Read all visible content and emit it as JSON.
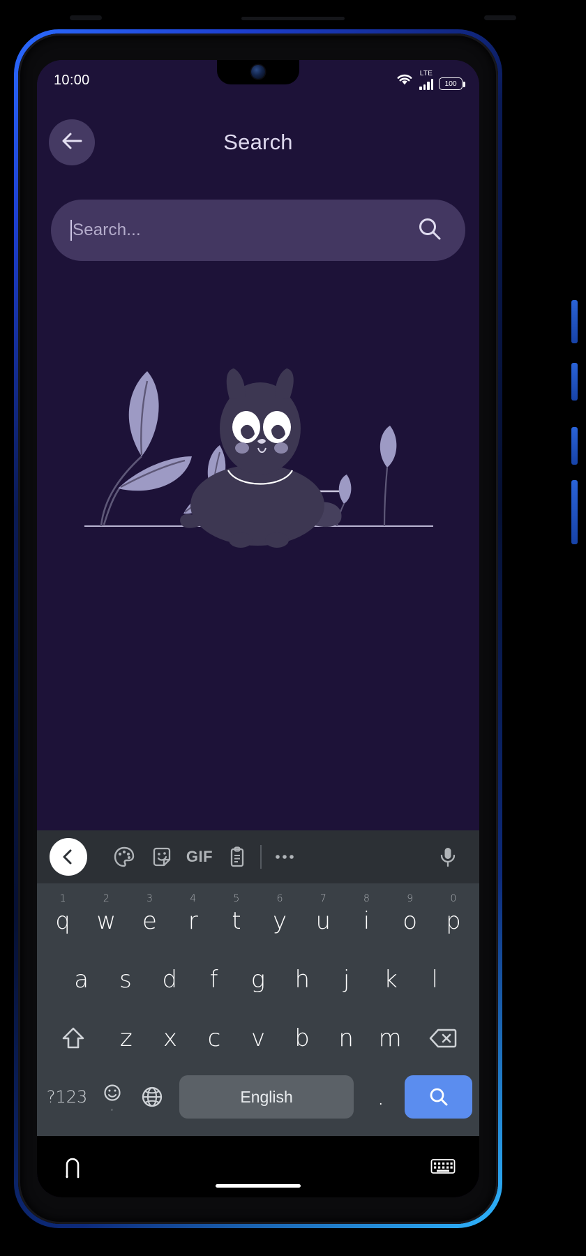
{
  "status_bar": {
    "time": "10:00",
    "wifi_icon": "wifi-icon",
    "network_label": "LTE",
    "signal_icon": "signal-bars-icon",
    "battery_level": "100"
  },
  "app_bar": {
    "back_icon": "arrow-left-icon",
    "title": "Search"
  },
  "search": {
    "placeholder": "Search...",
    "value": "",
    "search_icon": "search-icon"
  },
  "illustration": {
    "name": "empty-state-cat-illustration",
    "cat_body_color": "#3d3752",
    "leaf_color": "#9d9ac4",
    "ground_color": "#c8c4dd"
  },
  "theme": {
    "app_background": "#1d1238",
    "search_field_background": "#433761",
    "back_button_background": "#453a63",
    "title_color": "#ded9ee",
    "keyboard_toolbar_background": "#2c3035",
    "keyboard_background": "#3a4046",
    "spacebar_color": "#5b6167",
    "enter_key_color": "#5b8def",
    "frame_accent": "#2b6bff"
  },
  "keyboard": {
    "toolbar": [
      {
        "name": "collapse-toolbar-button",
        "icon": "chevron-left-icon",
        "label": ""
      },
      {
        "name": "theme-button",
        "icon": "palette-icon",
        "label": ""
      },
      {
        "name": "sticker-button",
        "icon": "sticker-icon",
        "label": ""
      },
      {
        "name": "gif-button",
        "icon": "gif-icon",
        "label": "GIF"
      },
      {
        "name": "clipboard-button",
        "icon": "clipboard-icon",
        "label": ""
      },
      {
        "name": "more-options-button",
        "icon": "ellipsis-icon",
        "label": ""
      },
      {
        "name": "voice-input-button",
        "icon": "microphone-icon",
        "label": ""
      }
    ],
    "row1": [
      {
        "key": "q",
        "num": "1"
      },
      {
        "key": "w",
        "num": "2"
      },
      {
        "key": "e",
        "num": "3"
      },
      {
        "key": "r",
        "num": "4"
      },
      {
        "key": "t",
        "num": "5"
      },
      {
        "key": "y",
        "num": "6"
      },
      {
        "key": "u",
        "num": "7"
      },
      {
        "key": "i",
        "num": "8"
      },
      {
        "key": "o",
        "num": "9"
      },
      {
        "key": "p",
        "num": "0"
      }
    ],
    "row2": [
      {
        "key": "a"
      },
      {
        "key": "s"
      },
      {
        "key": "d"
      },
      {
        "key": "f"
      },
      {
        "key": "g"
      },
      {
        "key": "h"
      },
      {
        "key": "j"
      },
      {
        "key": "k"
      },
      {
        "key": "l"
      }
    ],
    "row3": [
      {
        "key": "z"
      },
      {
        "key": "x"
      },
      {
        "key": "c"
      },
      {
        "key": "v"
      },
      {
        "key": "b"
      },
      {
        "key": "n"
      },
      {
        "key": "m"
      }
    ],
    "shift_icon": "shift-arrow-icon",
    "backspace_icon": "backspace-icon",
    "symbols_label": "?123",
    "emoji_icon": "emoji-smiley-icon",
    "comma_label": ",",
    "language_switch_icon": "globe-icon",
    "space_label": "English",
    "period_label": ".",
    "enter_icon": "search-icon"
  },
  "nav_bar": {
    "back_icon": "nav-back-icon",
    "home_indicator": "home-pill-indicator",
    "keyboard_icon": "keyboard-icon"
  }
}
